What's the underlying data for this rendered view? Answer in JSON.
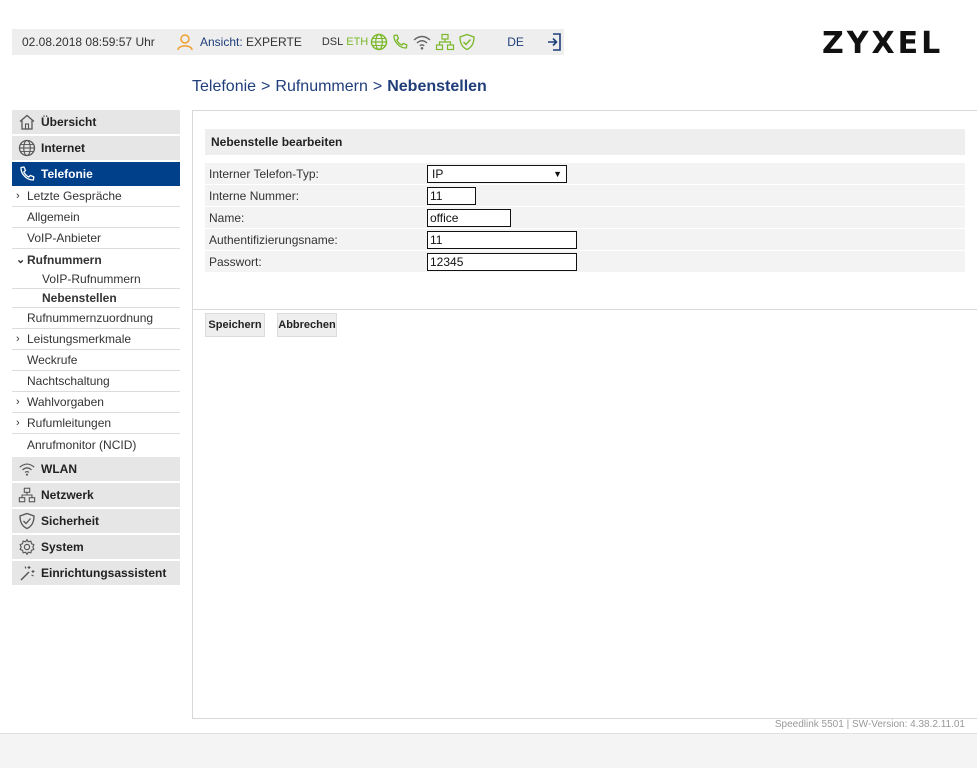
{
  "status": {
    "datetime": "02.08.2018 08:59:57 Uhr",
    "view_label": "Ansicht:",
    "view_value": "EXPERTE",
    "dsl": "DSL",
    "eth": "ETH",
    "lang": "DE"
  },
  "brand": "ZYXEL",
  "breadcrumb": {
    "level1": "Telefonie",
    "level2": "Rufnummern",
    "current": "Nebenstellen",
    "sep": ">"
  },
  "nav": {
    "overview": "Übersicht",
    "internet": "Internet",
    "telefonie": "Telefonie",
    "telefonie_items": [
      "Letzte Gespräche",
      "Allgemein",
      "VoIP-Anbieter",
      "Rufnummern",
      "VoIP-Rufnummern",
      "Nebenstellen",
      "Rufnummernzuordnung",
      "Leistungsmerkmale",
      "Weckrufe",
      "Nachtschaltung",
      "Wahlvorgaben",
      "Rufumleitungen",
      "Anrufmonitor (NCID)"
    ],
    "wlan": "WLAN",
    "netzwerk": "Netzwerk",
    "sicherheit": "Sicherheit",
    "system": "System",
    "assistent": "Einrichtungsassistent"
  },
  "panel": {
    "title": "Nebenstelle bearbeiten",
    "fields": {
      "type_label": "Interner Telefon-Typ:",
      "type_value": "IP",
      "number_label": "Interne Nummer:",
      "number_value": "11",
      "name_label": "Name:",
      "name_value": "office",
      "auth_label": "Authentifizierungsname:",
      "auth_value": "11",
      "password_label": "Passwort:",
      "password_value": "12345"
    }
  },
  "buttons": {
    "save": "Speichern",
    "cancel": "Abbrechen"
  },
  "footer": "Speedlink 5501 | SW-Version: 4.38.2.11.01",
  "colors": {
    "accent": "#003f8a",
    "status_ok": "#7ab829",
    "user_icon": "#f0a030"
  }
}
